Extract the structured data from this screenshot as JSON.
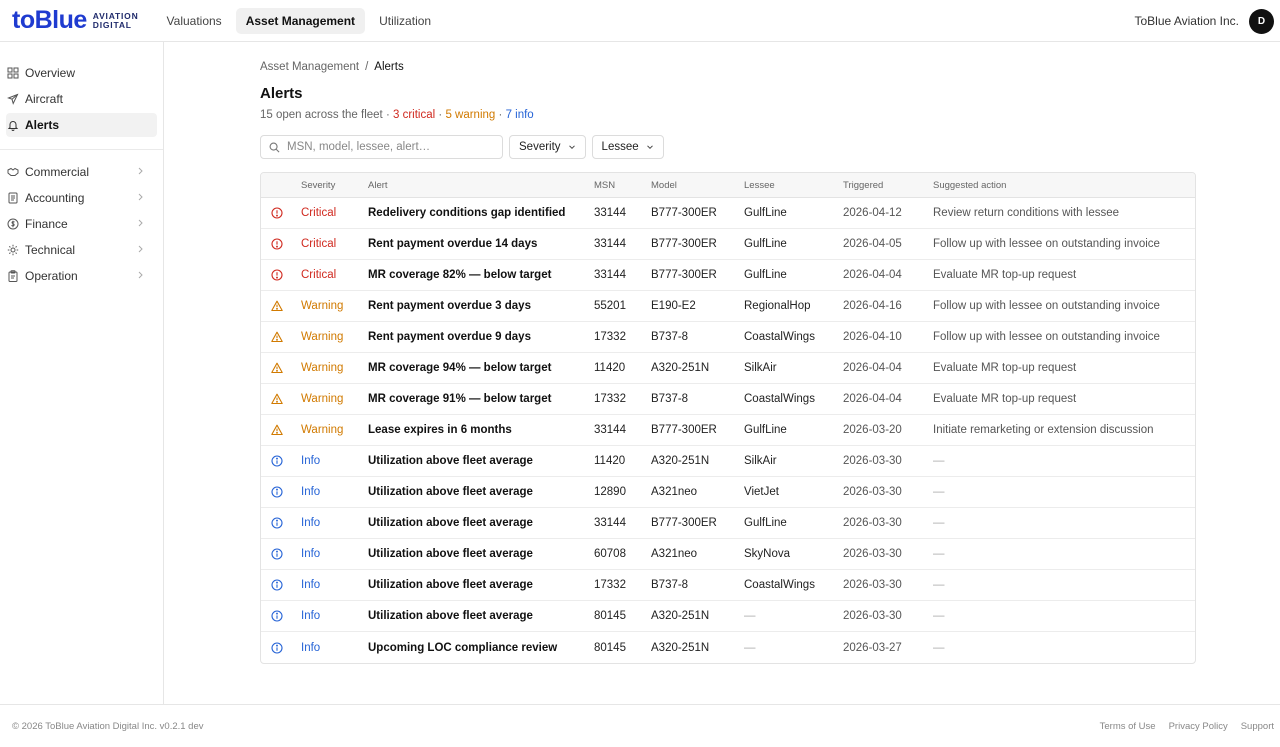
{
  "brand": {
    "word": "toBlue",
    "line1": "AVIATION",
    "line2": "DIGITAL"
  },
  "nav": [
    {
      "label": "Valuations"
    },
    {
      "label": "Asset Management"
    },
    {
      "label": "Utilization"
    }
  ],
  "org": {
    "name": "ToBlue Aviation Inc.",
    "avatar_initial": "D"
  },
  "sidebar": {
    "primary": [
      {
        "label": "Overview",
        "icon": "grid-icon"
      },
      {
        "label": "Aircraft",
        "icon": "plane-icon"
      },
      {
        "label": "Alerts",
        "icon": "bell-icon"
      }
    ],
    "secondary": [
      {
        "label": "Commercial",
        "icon": "handshake-icon"
      },
      {
        "label": "Accounting",
        "icon": "ledger-icon"
      },
      {
        "label": "Finance",
        "icon": "dollar-icon"
      },
      {
        "label": "Technical",
        "icon": "gear-icon"
      },
      {
        "label": "Operation",
        "icon": "clipboard-icon"
      }
    ]
  },
  "breadcrumb": {
    "parent": "Asset Management",
    "sep": "/",
    "current": "Alerts"
  },
  "page": {
    "title": "Alerts",
    "summary_prefix": "15 open across the fleet",
    "dot": "·",
    "critical": "3 critical",
    "warning": "5 warning",
    "info": "7 info"
  },
  "filters": {
    "search_placeholder": "MSN, model, lessee, alert…",
    "severity_label": "Severity",
    "lessee_label": "Lessee"
  },
  "table": {
    "headers": {
      "severity": "Severity",
      "alert": "Alert",
      "msn": "MSN",
      "model": "Model",
      "lessee": "Lessee",
      "triggered": "Triggered",
      "action": "Suggested action"
    },
    "rows": [
      {
        "severity": "Critical",
        "level": "critical",
        "alert": "Redelivery conditions gap identified",
        "msn": "33144",
        "model": "B777-300ER",
        "lessee": "GulfLine",
        "triggered": "2026-04-12",
        "action": "Review return conditions with lessee"
      },
      {
        "severity": "Critical",
        "level": "critical",
        "alert": "Rent payment overdue 14 days",
        "msn": "33144",
        "model": "B777-300ER",
        "lessee": "GulfLine",
        "triggered": "2026-04-05",
        "action": "Follow up with lessee on outstanding invoice"
      },
      {
        "severity": "Critical",
        "level": "critical",
        "alert": "MR coverage 82% — below target",
        "msn": "33144",
        "model": "B777-300ER",
        "lessee": "GulfLine",
        "triggered": "2026-04-04",
        "action": "Evaluate MR top-up request"
      },
      {
        "severity": "Warning",
        "level": "warning",
        "alert": "Rent payment overdue 3 days",
        "msn": "55201",
        "model": "E190-E2",
        "lessee": "RegionalHop",
        "triggered": "2026-04-16",
        "action": "Follow up with lessee on outstanding invoice"
      },
      {
        "severity": "Warning",
        "level": "warning",
        "alert": "Rent payment overdue 9 days",
        "msn": "17332",
        "model": "B737-8",
        "lessee": "CoastalWings",
        "triggered": "2026-04-10",
        "action": "Follow up with lessee on outstanding invoice"
      },
      {
        "severity": "Warning",
        "level": "warning",
        "alert": "MR coverage 94% — below target",
        "msn": "11420",
        "model": "A320-251N",
        "lessee": "SilkAir",
        "triggered": "2026-04-04",
        "action": "Evaluate MR top-up request"
      },
      {
        "severity": "Warning",
        "level": "warning",
        "alert": "MR coverage 91% — below target",
        "msn": "17332",
        "model": "B737-8",
        "lessee": "CoastalWings",
        "triggered": "2026-04-04",
        "action": "Evaluate MR top-up request"
      },
      {
        "severity": "Warning",
        "level": "warning",
        "alert": "Lease expires in 6 months",
        "msn": "33144",
        "model": "B777-300ER",
        "lessee": "GulfLine",
        "triggered": "2026-03-20",
        "action": "Initiate remarketing or extension discussion"
      },
      {
        "severity": "Info",
        "level": "info",
        "alert": "Utilization above fleet average",
        "msn": "11420",
        "model": "A320-251N",
        "lessee": "SilkAir",
        "triggered": "2026-03-30",
        "action": "—"
      },
      {
        "severity": "Info",
        "level": "info",
        "alert": "Utilization above fleet average",
        "msn": "12890",
        "model": "A321neo",
        "lessee": "VietJet",
        "triggered": "2026-03-30",
        "action": "—"
      },
      {
        "severity": "Info",
        "level": "info",
        "alert": "Utilization above fleet average",
        "msn": "33144",
        "model": "B777-300ER",
        "lessee": "GulfLine",
        "triggered": "2026-03-30",
        "action": "—"
      },
      {
        "severity": "Info",
        "level": "info",
        "alert": "Utilization above fleet average",
        "msn": "60708",
        "model": "A321neo",
        "lessee": "SkyNova",
        "triggered": "2026-03-30",
        "action": "—"
      },
      {
        "severity": "Info",
        "level": "info",
        "alert": "Utilization above fleet average",
        "msn": "17332",
        "model": "B737-8",
        "lessee": "CoastalWings",
        "triggered": "2026-03-30",
        "action": "—"
      },
      {
        "severity": "Info",
        "level": "info",
        "alert": "Utilization above fleet average",
        "msn": "80145",
        "model": "A320-251N",
        "lessee": "—",
        "triggered": "2026-03-30",
        "action": "—"
      },
      {
        "severity": "Info",
        "level": "info",
        "alert": "Upcoming LOC compliance review",
        "msn": "80145",
        "model": "A320-251N",
        "lessee": "—",
        "triggered": "2026-03-27",
        "action": "—"
      }
    ]
  },
  "footer": {
    "copyright": "© 2026 ToBlue Aviation Digital Inc. v0.2.1 dev",
    "links": [
      "Terms of Use",
      "Privacy Policy",
      "Support"
    ]
  },
  "colors": {
    "brand": "#1f3bd0",
    "critical": "#d0291f",
    "warning": "#d17a00",
    "info": "#2563d6"
  }
}
